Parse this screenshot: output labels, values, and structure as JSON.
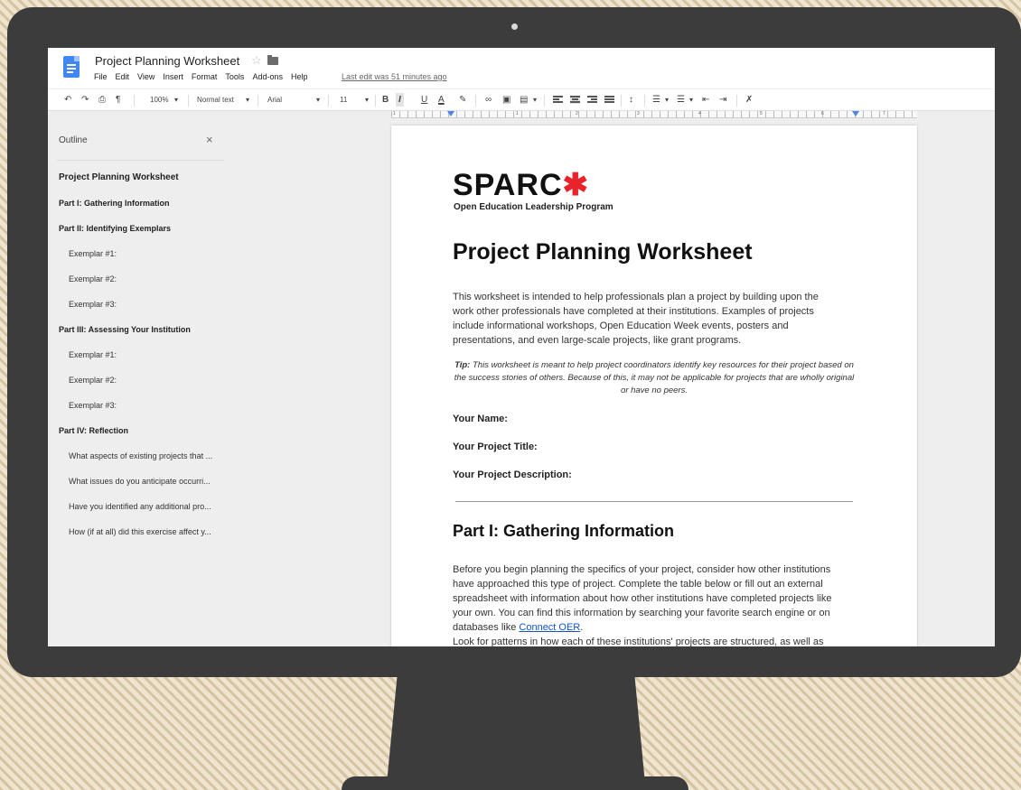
{
  "app": {
    "doc_title": "Project Planning Worksheet",
    "menu": [
      "File",
      "Edit",
      "View",
      "Insert",
      "Format",
      "Tools",
      "Add-ons",
      "Help"
    ],
    "last_edit": "Last edit was 51 minutes ago"
  },
  "toolbar": {
    "zoom": "100%",
    "style": "Normal text",
    "font": "Arial",
    "font_size": "11",
    "bold": "B",
    "italic": "I",
    "underline": "U",
    "text_color": "A"
  },
  "ruler": {
    "numbers": [
      "1",
      "1",
      "2",
      "3",
      "4",
      "5",
      "6",
      "7"
    ]
  },
  "outline": {
    "title": "Outline",
    "close": "×",
    "items": [
      {
        "label": "Project Planning Worksheet"
      },
      {
        "label": "Part I: Gathering Information"
      },
      {
        "label": "Part II: Identifying Exemplars"
      },
      {
        "label": "Exemplar #1:"
      },
      {
        "label": "Exemplar #2:"
      },
      {
        "label": "Exemplar #3:"
      },
      {
        "label": "Part III: Assessing Your Institution"
      },
      {
        "label": "Exemplar #1:"
      },
      {
        "label": "Exemplar #2:"
      },
      {
        "label": "Exemplar #3:"
      },
      {
        "label": "Part IV: Reflection"
      },
      {
        "label": "What aspects of existing projects that ..."
      },
      {
        "label": "What issues do you anticipate occurri..."
      },
      {
        "label": "Have you identified any additional pro..."
      },
      {
        "label": "How (if at all) did this exercise affect y..."
      }
    ]
  },
  "document": {
    "logo_text": "SPARC",
    "logo_star": "✱",
    "logo_subtitle": "Open Education Leadership Program",
    "heading": "Project Planning Worksheet",
    "intro": "This worksheet is intended to help professionals plan a project by building upon the work other professionals have completed at their institutions. Examples of projects include informational workshops, Open Education Week events, posters and presentations, and even large-scale projects, like grant programs.",
    "tip_label": "Tip:",
    "tip_text": " This worksheet is meant to help project coordinators identify key resources for their project based on the success stories of others. Because of this, it may not be applicable for projects that are wholly original or have no peers.",
    "field_name": "Your Name:",
    "field_title": "Your Project Title:",
    "field_description": "Your Project Description:",
    "part1_heading": "Part I: Gathering Information",
    "part1_body": "Before you begin planning the specifics of your project, consider how other institutions have approached this type of project. Complete the table below or fill out an external spreadsheet with information about how other institutions have completed projects like your own. You can find this information by searching your favorite search engine or on databases like ",
    "part1_link": "Connect OER",
    "part1_body_end": ".",
    "part1_body2": "Look for patterns in how each of these institutions' projects are structured, as well as"
  }
}
